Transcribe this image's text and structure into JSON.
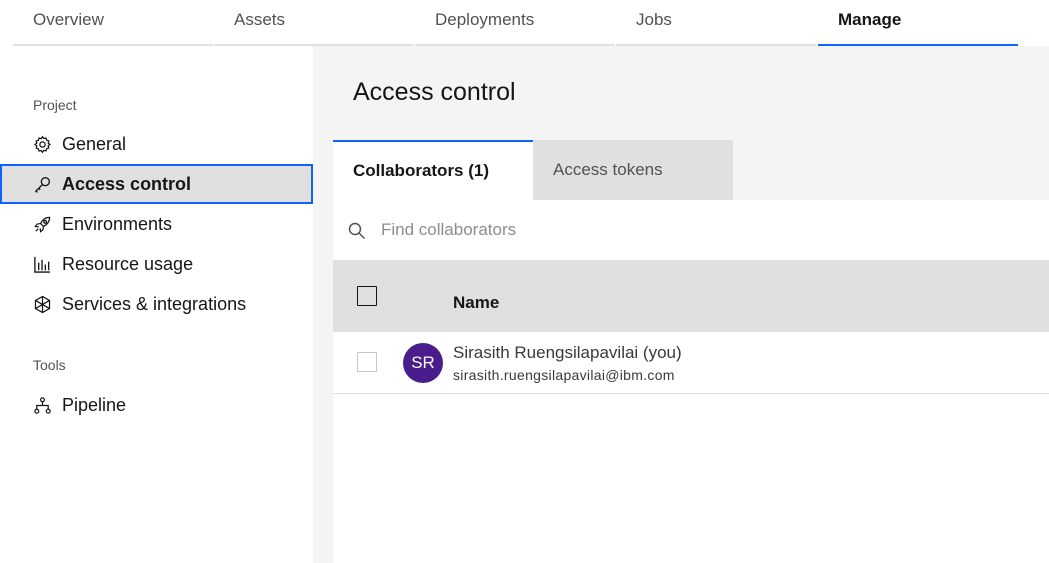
{
  "top_tabs": [
    {
      "label": "Overview",
      "active": false
    },
    {
      "label": "Assets",
      "active": false
    },
    {
      "label": "Deployments",
      "active": false
    },
    {
      "label": "Jobs",
      "active": false
    },
    {
      "label": "Manage",
      "active": true
    }
  ],
  "sidebar": {
    "project_heading": "Project",
    "items": [
      {
        "label": "General",
        "icon": "gear-icon",
        "active": false
      },
      {
        "label": "Access control",
        "icon": "key-icon",
        "active": true
      },
      {
        "label": "Environments",
        "icon": "rocket-icon",
        "active": false
      },
      {
        "label": "Resource usage",
        "icon": "bar-chart-icon",
        "active": false
      },
      {
        "label": "Services & integrations",
        "icon": "integrations-icon",
        "active": false
      }
    ],
    "tools_heading": "Tools",
    "tools": [
      {
        "label": "Pipeline",
        "icon": "pipeline-icon",
        "active": false
      }
    ]
  },
  "main": {
    "title": "Access control",
    "tabs": [
      {
        "label": "Collaborators (1)",
        "active": true
      },
      {
        "label": "Access tokens",
        "active": false
      }
    ],
    "search": {
      "placeholder": "Find collaborators",
      "value": ""
    },
    "table": {
      "columns": [
        "Name"
      ],
      "rows": [
        {
          "initials": "SR",
          "name": "Sirasith Ruengsilapavilai (you)",
          "email": "sirasith.ruengsilapavilai@ibm.com",
          "avatar_color": "#491d8b"
        }
      ]
    }
  },
  "colors": {
    "accent": "#0f62fe",
    "avatar": "#491d8b",
    "surface": "#f4f4f4",
    "selected": "#e0e0e0"
  }
}
